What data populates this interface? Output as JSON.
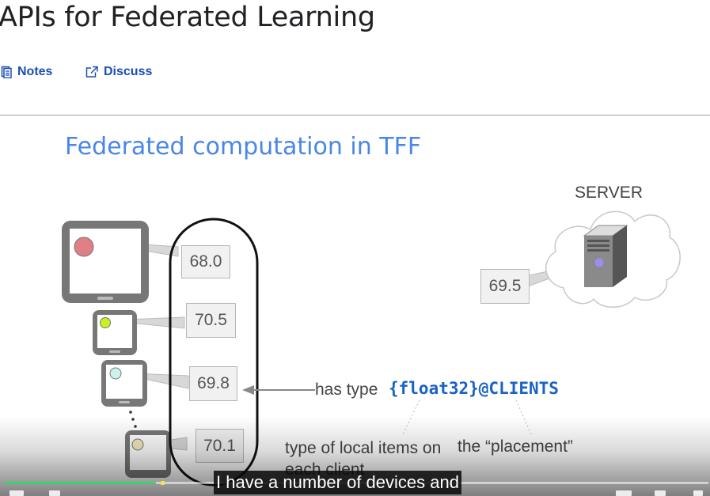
{
  "page": {
    "title": "APIs for Federated Learning"
  },
  "actions": {
    "notes_label": "Notes",
    "discuss_label": "Discuss"
  },
  "slide": {
    "title": "Federated computation in TFF",
    "server_label": "SERVER",
    "server_value": "69.5",
    "client_values": [
      "68.0",
      "70.5",
      "69.8",
      "70.1"
    ],
    "has_type_label": "has type",
    "type_code": "{float32}@CLIENTS",
    "note_local_items": "type of local items on each client",
    "note_placement": "the “placement”",
    "colors": {
      "title": "#4a86e8",
      "code": "#1a62c4"
    }
  },
  "player": {
    "caption": "I have a number of devices and",
    "progress_percent": 21.5
  }
}
